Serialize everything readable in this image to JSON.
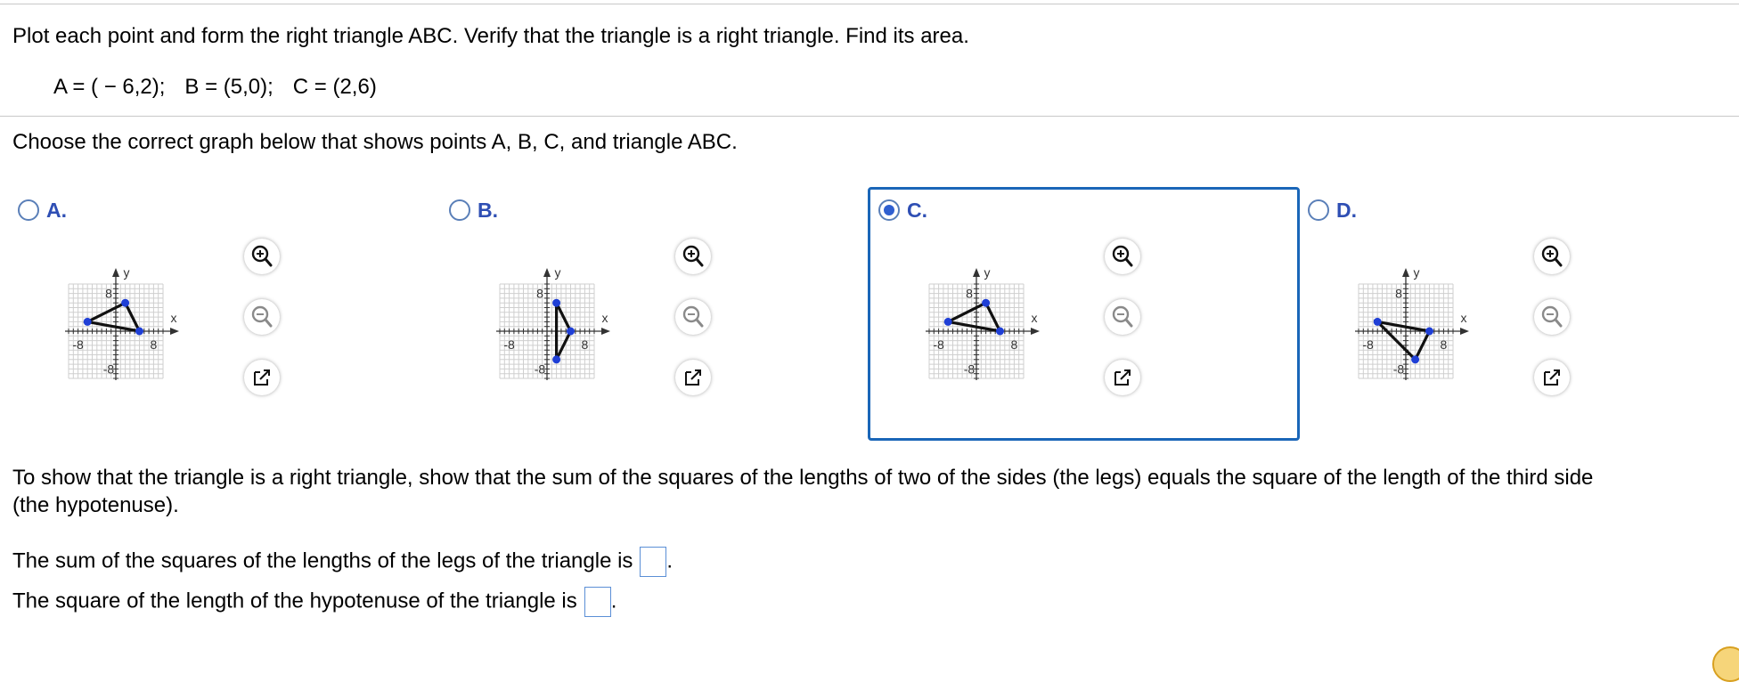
{
  "question": {
    "instruction": "Plot each point and form the right triangle ABC. Verify that the triangle is a right triangle. Find its area.",
    "points": [
      "A = ( − 6,2);",
      "B = (5,0);",
      "C = (2,6)"
    ],
    "prompt": "Choose the correct graph below that shows points A, B, C, and triangle ABC."
  },
  "choices": [
    {
      "label": "A.",
      "selected": false,
      "vertices": [
        [
          -6,
          2
        ],
        [
          5,
          0
        ],
        [
          2,
          6
        ]
      ]
    },
    {
      "label": "B.",
      "selected": false,
      "vertices": [
        [
          2,
          6
        ],
        [
          5,
          0
        ],
        [
          2,
          -6
        ]
      ]
    },
    {
      "label": "C.",
      "selected": true,
      "vertices": [
        [
          -6,
          2
        ],
        [
          5,
          0
        ],
        [
          2,
          6
        ]
      ]
    },
    {
      "label": "D.",
      "selected": false,
      "vertices": [
        [
          -6,
          2
        ],
        [
          5,
          0
        ],
        [
          2,
          -6
        ]
      ]
    }
  ],
  "graph_labels": {
    "y": "y",
    "x": "x",
    "tick_pos": "8",
    "tick_neg": "-8"
  },
  "tools": [
    "zoom-in-icon",
    "zoom-out-icon",
    "popout-icon"
  ],
  "explanation": "To show that the triangle is a right triangle, show that the sum of the squares of the lengths of two of the sides (the legs) equals the square of the length of the third side",
  "explanation_cont": "(the hypotenuse).",
  "answers": {
    "sum_legs_label": "The sum of the squares of the lengths of the legs of the triangle is",
    "hypotenuse_label": "The square of the length of the hypotenuse of the triangle is",
    "sum_legs_value": "",
    "hypotenuse_value": ""
  },
  "colors": {
    "accent": "#2f4fb4",
    "point": "#1f3fd6",
    "selected_border": "#1a66b8"
  }
}
